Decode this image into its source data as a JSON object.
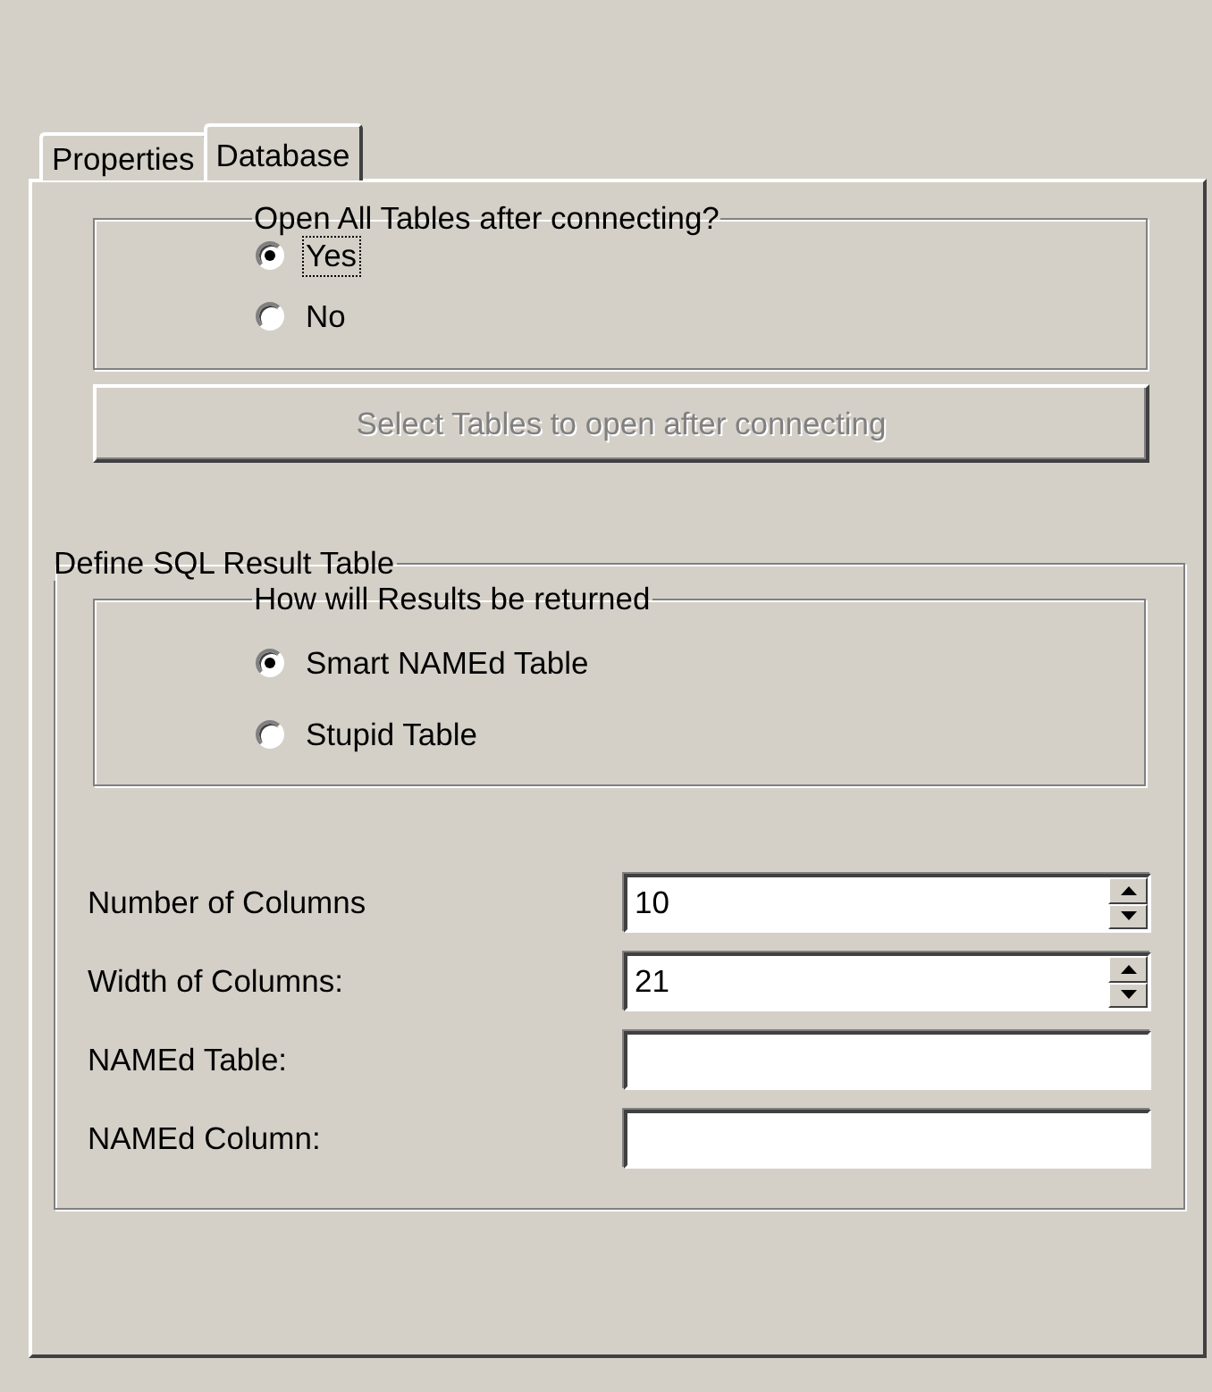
{
  "tabs": [
    {
      "label": "Properties",
      "selected": false
    },
    {
      "label": "Database",
      "selected": true
    }
  ],
  "open_tables_group": {
    "title": "Open All Tables after connecting?",
    "options": [
      {
        "label": "Yes",
        "selected": true,
        "focused": true
      },
      {
        "label": "No",
        "selected": false,
        "focused": false
      }
    ]
  },
  "select_tables_button": {
    "label": "Select Tables to open after connecting",
    "disabled": true
  },
  "sql_result_group": {
    "title": "Define SQL Result Table",
    "results_group": {
      "title": "How will Results be returned",
      "options": [
        {
          "label": "Smart NAMEd Table",
          "selected": true,
          "focused": false
        },
        {
          "label": "Stupid Table",
          "selected": false,
          "focused": false
        }
      ]
    },
    "fields": [
      {
        "label": "Number of Columns",
        "value": "10",
        "kind": "spinner"
      },
      {
        "label": "Width of Columns:",
        "value": "21",
        "kind": "spinner"
      },
      {
        "label": "NAMEd Table:",
        "kind": "text"
      },
      {
        "label": "NAMEd Column:",
        "kind": "text"
      }
    ]
  }
}
